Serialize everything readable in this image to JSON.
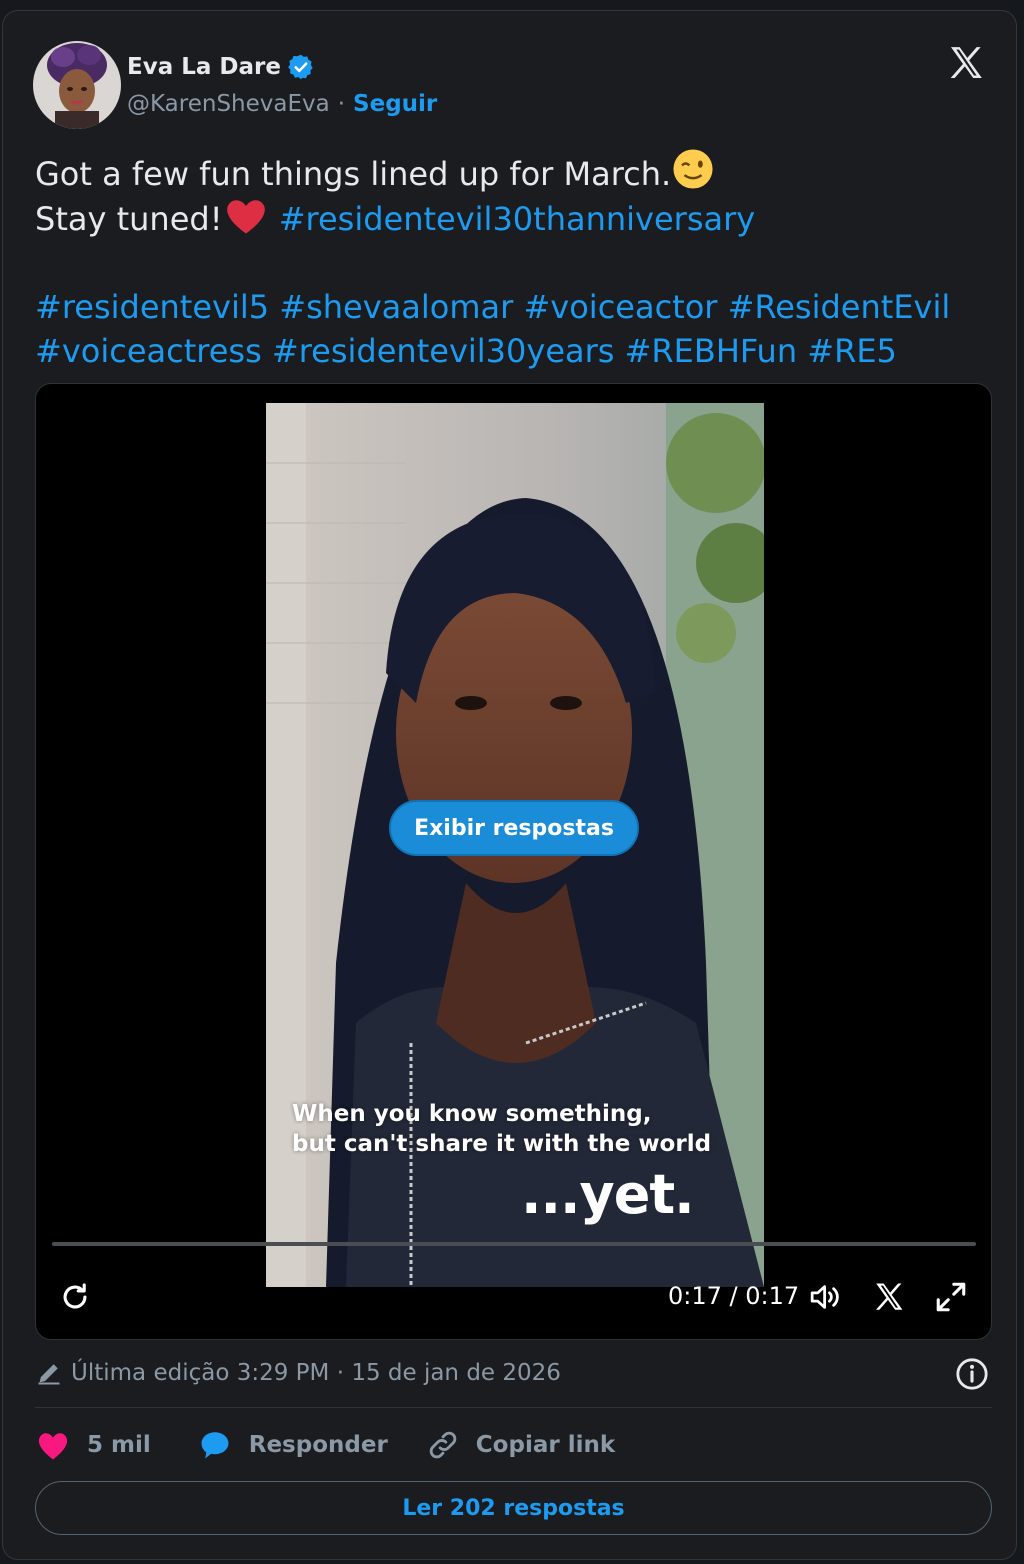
{
  "author": {
    "name": "Eva La Dare",
    "handle": "@KarenShevaEva",
    "separator": "·",
    "follow_label": "Seguir"
  },
  "tweet": {
    "line1_text": "Got a few fun things lined up for March.",
    "line2_text": "Stay tuned!",
    "line2_hashtag": "#residentevil30thanniversary",
    "hashtags_line3": [
      "#residentevil5",
      "#shevaalomar",
      "#voiceactor",
      "#ResidentEvil"
    ],
    "hashtags_line4": [
      "#voiceactress",
      "#residentevil30years",
      "#REBHFun",
      "#RE5"
    ]
  },
  "video": {
    "caption_line1": "When you know something,",
    "caption_line2": "but can't share it with the world",
    "caption_big": "...yet.",
    "show_replies_label": "Exibir respostas",
    "time": "0:17 / 0:17",
    "progress": 1.0
  },
  "meta": {
    "edited_label": "Última edição 3:29 PM · 15 de jan de 2026"
  },
  "actions": {
    "likes": "5 mil",
    "reply_label": "Responder",
    "copy_link_label": "Copiar link"
  },
  "read_replies_label": "Ler 202 respostas",
  "icons": {
    "verified": "verified-badge-icon",
    "logo": "x-logo-icon",
    "heart": "heart-icon",
    "reply": "reply-bubble-icon",
    "link": "link-icon",
    "info": "info-icon",
    "pencil": "pencil-icon",
    "replay": "replay-icon",
    "volume": "volume-icon",
    "fullscreen": "fullscreen-icon"
  },
  "colors": {
    "accent": "#1d9bf0",
    "heart": "#f91880",
    "background": "#1a1c1f",
    "muted_text": "#8b98a5"
  }
}
